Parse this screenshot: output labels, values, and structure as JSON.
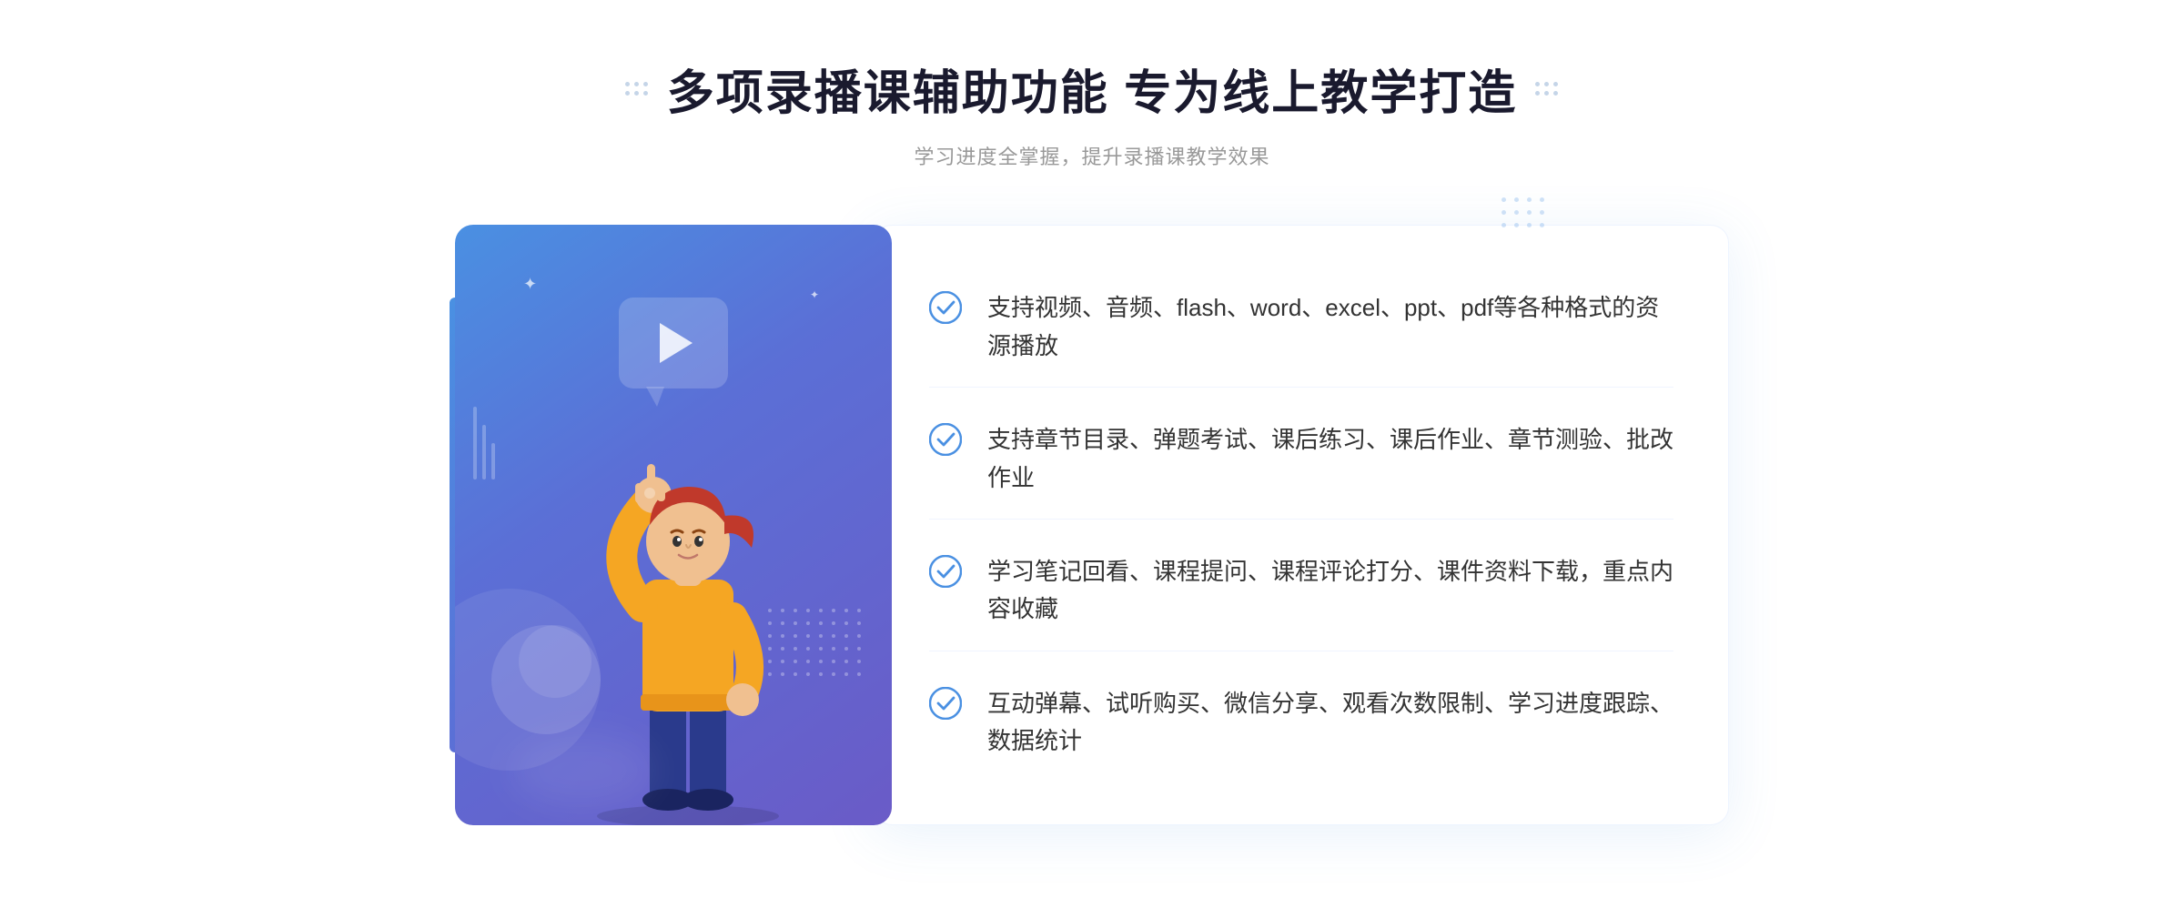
{
  "header": {
    "title": "多项录播课辅助功能 专为线上教学打造",
    "subtitle": "学习进度全掌握，提升录播课教学效果",
    "dots_decoration": true
  },
  "features": [
    {
      "id": 1,
      "text": "支持视频、音频、flash、word、excel、ppt、pdf等各种格式的资源播放"
    },
    {
      "id": 2,
      "text": "支持章节目录、弹题考试、课后练习、课后作业、章节测验、批改作业"
    },
    {
      "id": 3,
      "text": "学习笔记回看、课程提问、课程评论打分、课件资料下载，重点内容收藏"
    },
    {
      "id": 4,
      "text": "互动弹幕、试听购买、微信分享、观看次数限制、学习进度跟踪、数据统计"
    }
  ],
  "colors": {
    "accent_blue": "#4a90e2",
    "gradient_start": "#4a90e2",
    "gradient_end": "#6a5bc7",
    "text_dark": "#1a1a2e",
    "text_gray": "#999999",
    "text_body": "#333333"
  }
}
